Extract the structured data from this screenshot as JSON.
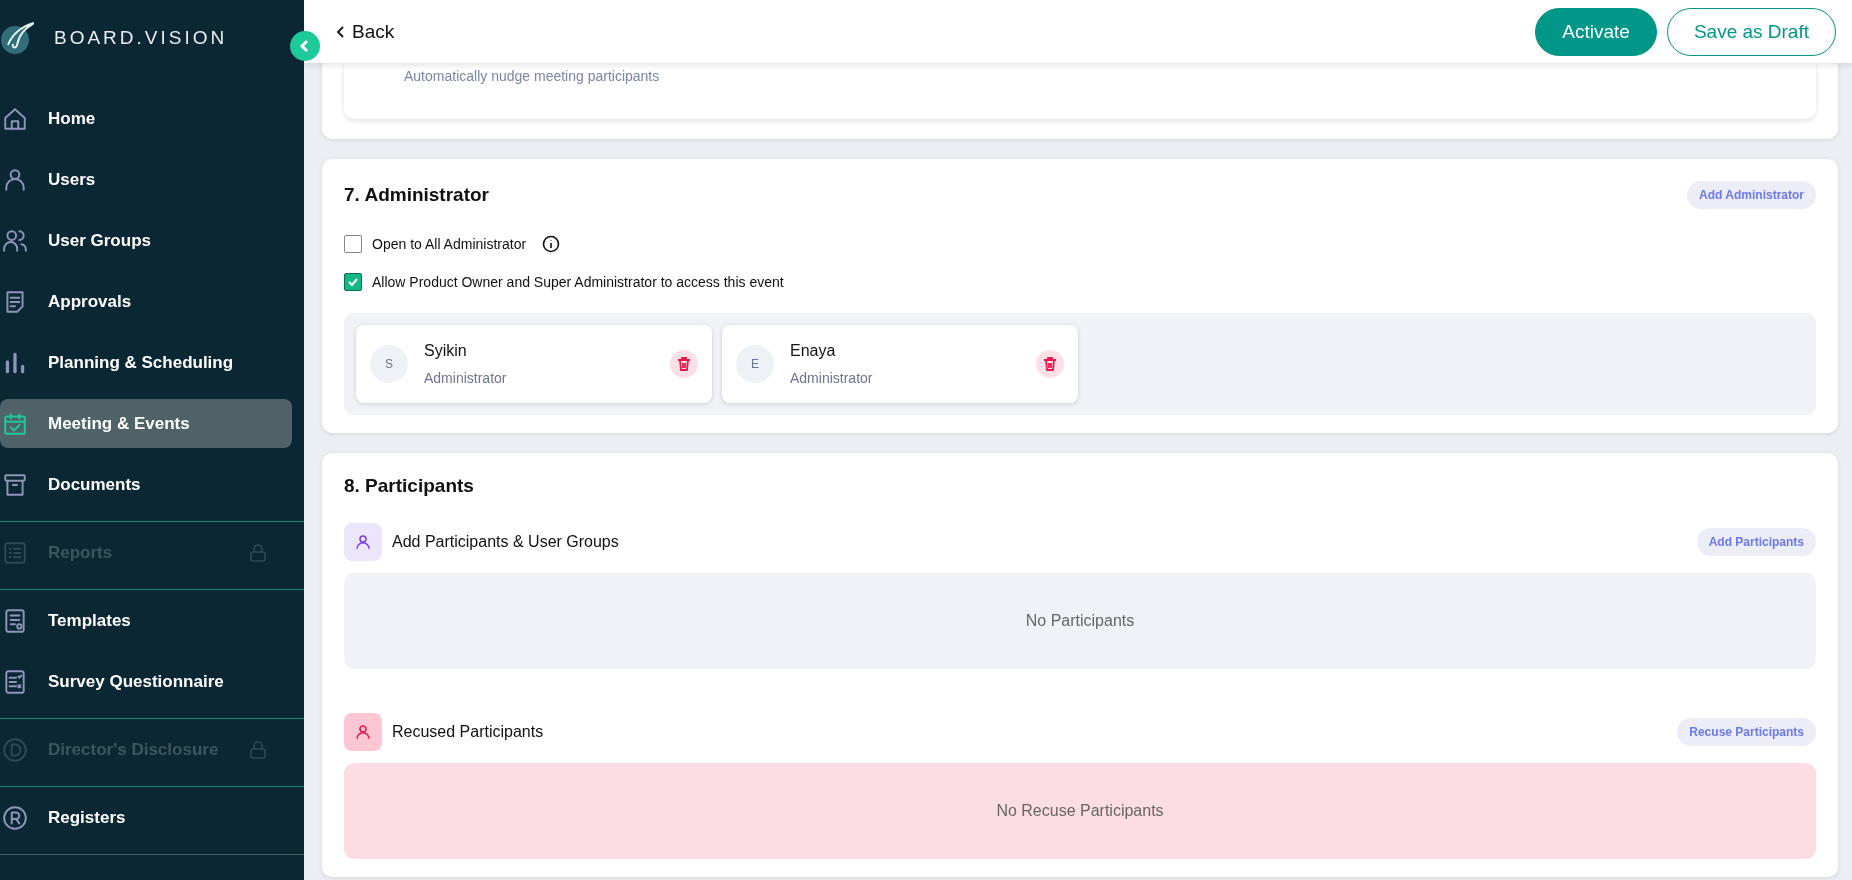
{
  "sidebar": {
    "brand": "BOARD.VISION",
    "groups": [
      [
        {
          "label": "Home",
          "selected": false,
          "locked": false
        },
        {
          "label": "Users",
          "selected": false,
          "locked": false
        },
        {
          "label": "User Groups",
          "selected": false,
          "locked": false
        },
        {
          "label": "Approvals",
          "selected": false,
          "locked": false
        },
        {
          "label": "Planning & Scheduling",
          "selected": false,
          "locked": false
        },
        {
          "label": "Meeting & Events",
          "selected": true,
          "locked": false
        },
        {
          "label": "Documents",
          "selected": false,
          "locked": false
        }
      ],
      [
        {
          "label": "Reports",
          "selected": false,
          "locked": true
        }
      ],
      [
        {
          "label": "Templates",
          "selected": false,
          "locked": false
        },
        {
          "label": "Survey Questionnaire",
          "selected": false,
          "locked": false
        }
      ],
      [
        {
          "label": "Director's Disclosure",
          "selected": false,
          "locked": true
        }
      ],
      [
        {
          "label": "Registers",
          "selected": false,
          "locked": false
        }
      ]
    ]
  },
  "header": {
    "back": "Back",
    "buttons": [
      {
        "label": "Activate",
        "kind": "primary"
      },
      {
        "label": "Save as Draft",
        "kind": "outline"
      }
    ]
  },
  "previous_section": {
    "note": "Automatically nudge meeting participants"
  },
  "administrator": {
    "title": "7. Administrator",
    "add_button": "Add Administrator",
    "options": [
      {
        "label": "Open to All Administrator",
        "checked": false,
        "info": true
      },
      {
        "label": "Allow Product Owner and Super Administrator to access this event",
        "checked": true,
        "info": false
      }
    ],
    "admins": [
      {
        "initial": "S",
        "name": "Syikin",
        "role": "Administrator"
      },
      {
        "initial": "E",
        "name": "Enaya",
        "role": "Administrator"
      }
    ]
  },
  "participants": {
    "title": "8. Participants",
    "groups": [
      {
        "kind": "add",
        "title": "Add Participants & User Groups",
        "button": "Add Participants",
        "empty_text": "No Participants"
      },
      {
        "kind": "recused",
        "title": "Recused Participants",
        "button": "Recuse Participants",
        "empty_text": "No Recuse Participants"
      }
    ]
  }
}
